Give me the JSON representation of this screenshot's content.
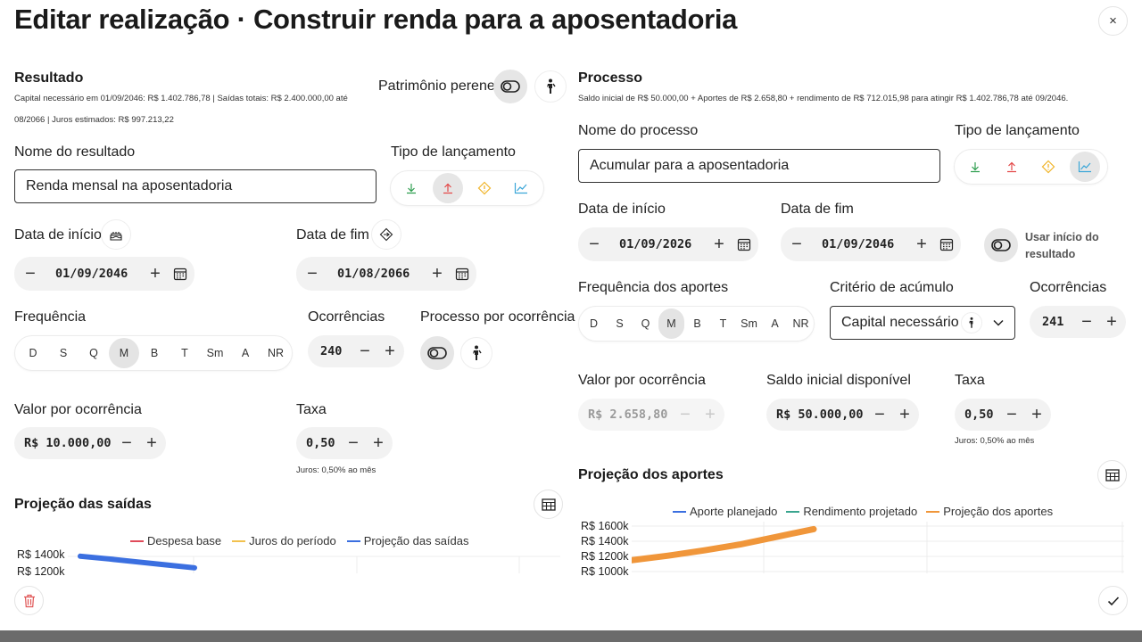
{
  "dialog": {
    "title": "Editar realização · Construir renda para a aposentadoria",
    "close_label": "×"
  },
  "result": {
    "title": "Resultado",
    "summary_line1": "Capital necessário em 01/09/2046: R$ 1.402.786,78 | Saídas totais: R$ 2.400.000,00 até",
    "summary_line2": "08/2066 | Juros estimados: R$ 997.213,22",
    "perennial_label": "Patrimônio perene",
    "name_label": "Nome do resultado",
    "name_value": "Renda mensal na aposentadoria",
    "type_label": "Tipo de lançamento",
    "type_options": [
      {
        "icon": "arrow-down-icon",
        "color": "#2e9e4f"
      },
      {
        "icon": "arrow-up-icon",
        "color": "#e34848",
        "active": true
      },
      {
        "icon": "diamond-alert-icon",
        "color": "#f0b428"
      },
      {
        "icon": "trend-chart-icon",
        "color": "#3aa6d8"
      }
    ],
    "start_label": "Data de início",
    "start_value": "01/09/2046",
    "end_label": "Data de fim",
    "end_value": "01/08/2066",
    "frequency_label": "Frequência",
    "frequency_options": [
      "D",
      "S",
      "Q",
      "M",
      "B",
      "T",
      "Sm",
      "A",
      "NR"
    ],
    "frequency_selected": "M",
    "occurrences_label": "Ocorrências",
    "occurrences_value": "240",
    "process_per_occurrence_label": "Processo por ocorrência",
    "value_label": "Valor por ocorrência",
    "value_value": "R$ 10.000,00",
    "rate_label": "Taxa",
    "rate_value": "0,50",
    "rate_note": "Juros: 0,50% ao mês",
    "projection_title": "Projeção das saídas"
  },
  "process": {
    "title": "Processo",
    "summary": "Saldo inicial de R$ 50.000,00 + Aportes de R$ 2.658,80 + rendimento de R$ 712.015,98 para atingir R$ 1.402.786,78 até 09/2046.",
    "name_label": "Nome do processo",
    "name_value": "Acumular para a aposentadoria",
    "type_label": "Tipo de lançamento",
    "type_options": [
      {
        "icon": "arrow-down-icon",
        "color": "#2e9e4f"
      },
      {
        "icon": "arrow-up-icon",
        "color": "#e34848"
      },
      {
        "icon": "diamond-alert-icon",
        "color": "#f0b428"
      },
      {
        "icon": "trend-chart-icon",
        "color": "#3aa6d8",
        "active": true
      }
    ],
    "start_label": "Data de início",
    "start_value": "01/09/2026",
    "end_label": "Data de fim",
    "end_value": "01/09/2046",
    "use_result_start_line1": "Usar início do",
    "use_result_start_line2": "resultado",
    "frequency_label": "Frequência dos aportes",
    "frequency_options": [
      "D",
      "S",
      "Q",
      "M",
      "B",
      "T",
      "Sm",
      "A",
      "NR"
    ],
    "frequency_selected": "M",
    "criteria_label": "Critério de acúmulo",
    "criteria_value": "Capital necessário",
    "occurrences_label": "Ocorrências",
    "occurrences_value": "241",
    "value_label": "Valor por ocorrência",
    "value_value": "R$ 2.658,80",
    "initial_balance_label": "Saldo inicial disponível",
    "initial_balance_value": "R$ 50.000,00",
    "rate_label": "Taxa",
    "rate_value": "0,50",
    "rate_note": "Juros: 0,50% ao mês",
    "projection_title": "Projeção dos aportes"
  },
  "chart_data": [
    {
      "type": "line",
      "title": "Projeção das saídas",
      "series": [
        {
          "name": "Despesa base",
          "color": "#e04b5a"
        },
        {
          "name": "Juros do período",
          "color": "#f2c14e"
        },
        {
          "name": "Projeção das saídas",
          "color": "#3b6fe0"
        }
      ],
      "y_ticks": [
        "R$ 1400k",
        "R$ 1200k"
      ],
      "visible_projection_values_k": [
        1402,
        1370,
        1335,
        1300,
        1265
      ]
    },
    {
      "type": "line",
      "title": "Projeção dos aportes",
      "series": [
        {
          "name": "Aporte planejado",
          "color": "#3b6fe0"
        },
        {
          "name": "Rendimento projetado",
          "color": "#3aa58f"
        },
        {
          "name": "Projeção dos aportes",
          "color": "#f0963a"
        }
      ],
      "y_ticks": [
        "R$ 1600k",
        "R$ 1400k",
        "R$ 1200k",
        "R$ 1000k"
      ],
      "visible_projection_values_k": [
        1150,
        1210,
        1280,
        1360,
        1460,
        1560
      ]
    }
  ]
}
